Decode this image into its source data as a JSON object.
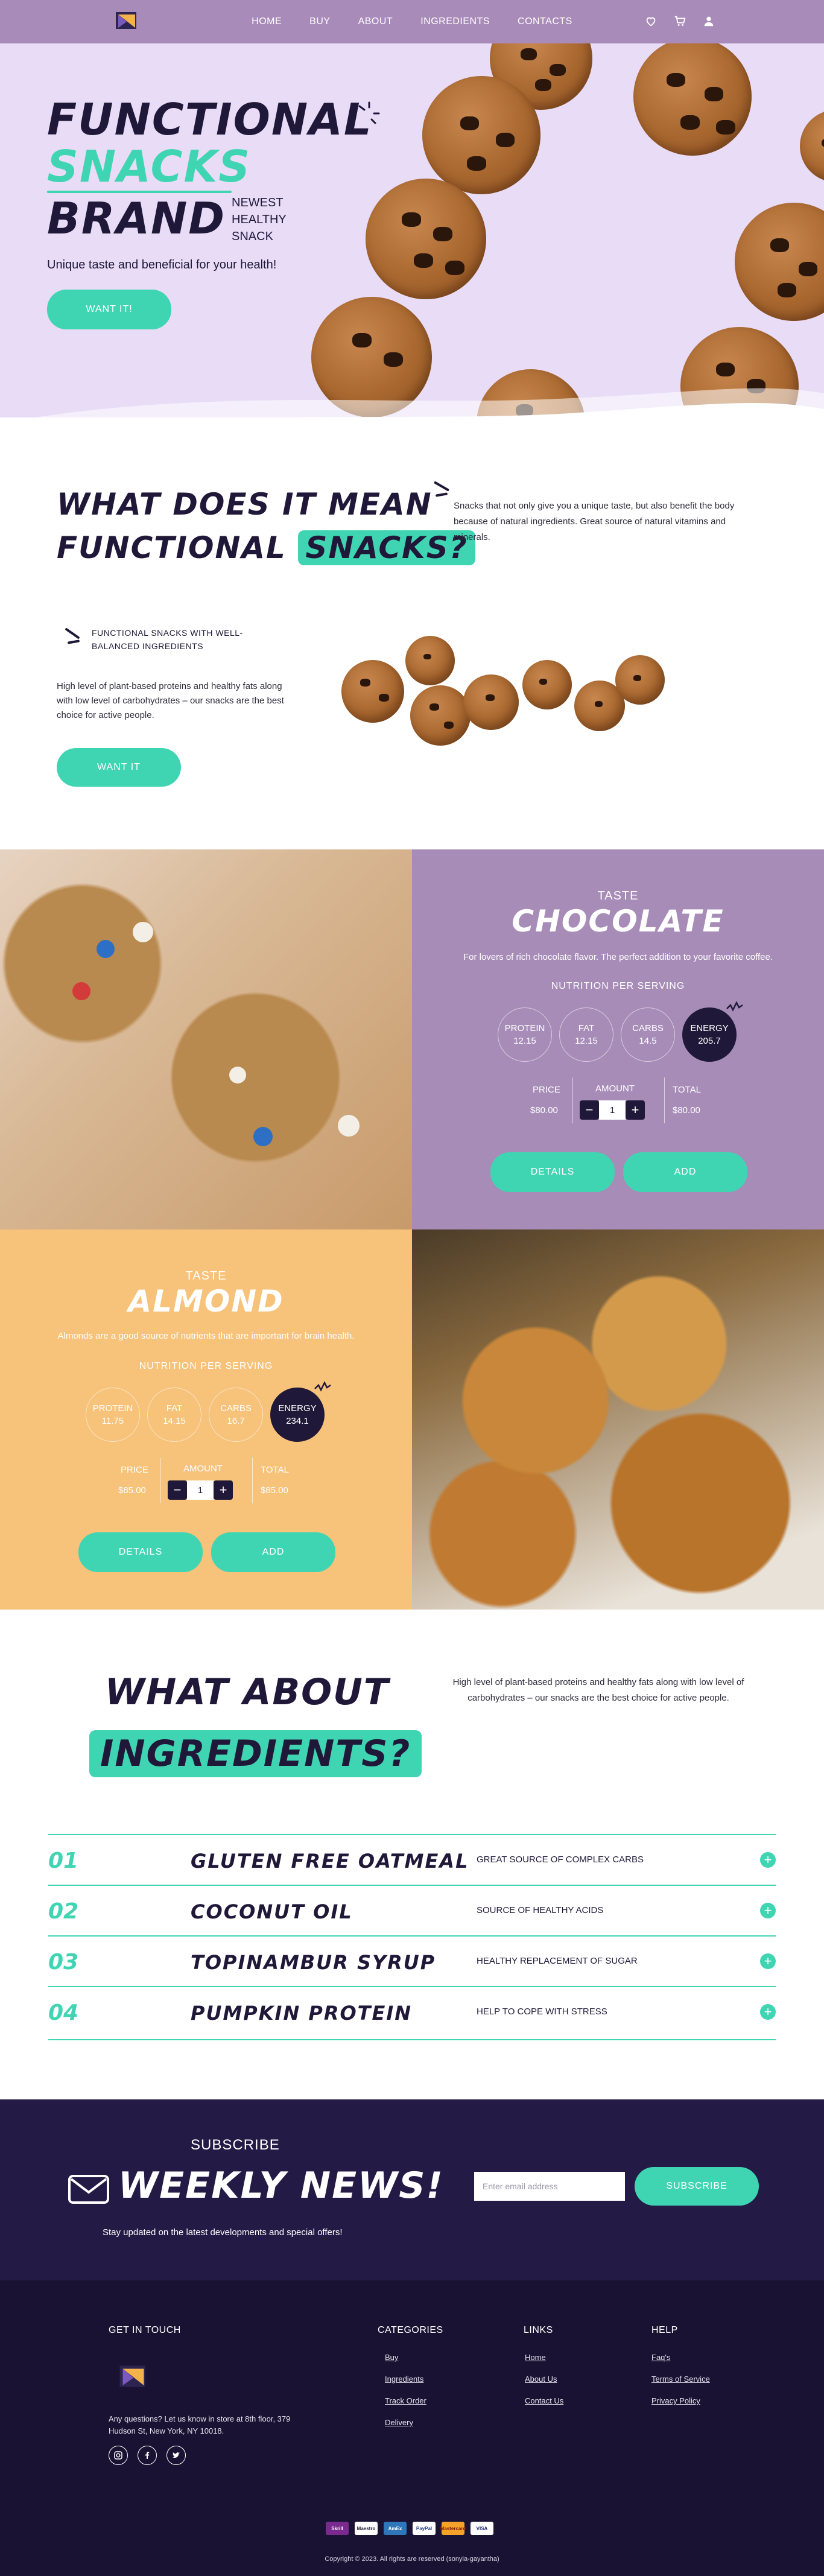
{
  "nav": {
    "items": [
      "HOME",
      "BUY",
      "ABOUT",
      "INGREDIENTS",
      "CONTACTS"
    ],
    "icons": [
      "heart-icon",
      "cart-icon",
      "user-icon"
    ]
  },
  "hero": {
    "line1": "FUNCTIONAL",
    "line2": "SNACKS",
    "line3": "BRAND",
    "tag1": "NEWEST",
    "tag2": "HEALTHY",
    "tag3": "SNACK",
    "subtitle": "Unique taste and beneficial for your health!",
    "cta": "WANT IT!"
  },
  "meaning": {
    "title_line1": "WHAT DOES IT MEAN",
    "title_line2_a": "FUNCTIONAL",
    "title_line2_b": "SNACKS?",
    "description": "Snacks that not only give you a unique taste, but also benefit the body because of natural ingredients. Great source of natural vitamins and minerals.",
    "feature_title": "FUNCTIONAL SNACKS WITH WELL-BALANCED INGREDIENTS",
    "feature_desc": "High level of plant-based proteins and healthy fats along with low level of carbohydrates – our snacks are the best choice for active people.",
    "cta": "WANT IT"
  },
  "products": [
    {
      "taste_label": "TASTE",
      "name": "CHOCOLATE",
      "description": "For lovers of rich chocolate flavor. The perfect addition to your favorite coffee.",
      "nutrition_label": "NUTRITION PER SERVING",
      "nutrients": [
        {
          "label": "PROTEIN",
          "value": "12.15"
        },
        {
          "label": "FAT",
          "value": "12.15"
        },
        {
          "label": "CARBS",
          "value": "14.5"
        },
        {
          "label": "ENERGY",
          "value": "205.7"
        }
      ],
      "price_label": "PRICE",
      "price": "$80.00",
      "amount_label": "AMOUNT",
      "amount": "1",
      "total_label": "TOTAL",
      "total": "$80.00",
      "details": "DETAILS",
      "add": "ADD",
      "panel_color": "#a78cb8"
    },
    {
      "taste_label": "TASTE",
      "name": "ALMOND",
      "description": "Almonds are a good source of nutrients that are important for brain health.",
      "nutrition_label": "NUTRITION PER SERVING",
      "nutrients": [
        {
          "label": "PROTEIN",
          "value": "11.75"
        },
        {
          "label": "FAT",
          "value": "14.15"
        },
        {
          "label": "CARBS",
          "value": "16.7"
        },
        {
          "label": "ENERGY",
          "value": "234.1"
        }
      ],
      "price_label": "PRICE",
      "price": "$85.00",
      "amount_label": "AMOUNT",
      "amount": "1",
      "total_label": "TOTAL",
      "total": "$85.00",
      "details": "DETAILS",
      "add": "ADD",
      "panel_color": "#f7c27a"
    }
  ],
  "ingredients": {
    "title_line1": "WHAT ABOUT",
    "title_line2": "INGREDIENTS?",
    "description": "High level of plant-based proteins and healthy fats along with low level of carbohydrates – our snacks are the best choice for active people.",
    "items": [
      {
        "num": "01",
        "name": "GLUTEN FREE OATMEAL",
        "benefit": "GREAT SOURCE OF COMPLEX CARBS"
      },
      {
        "num": "02",
        "name": "COCONUT OIL",
        "benefit": "SOURCE OF HEALTHY ACIDS"
      },
      {
        "num": "03",
        "name": "TOPINAMBUR SYRUP",
        "benefit": "HEALTHY REPLACEMENT OF SUGAR"
      },
      {
        "num": "04",
        "name": "PUMPKIN PROTEIN",
        "benefit": "HELP TO COPE WITH STRESS"
      }
    ]
  },
  "subscribe": {
    "label": "SUBSCRIBE",
    "title": "WEEKLY NEWS!",
    "text": "Stay updated on the latest developments and special offers!",
    "email_placeholder": "Enter email address",
    "button": "SUBSCRIBE"
  },
  "footer": {
    "contact_heading": "GET IN TOUCH",
    "address": "Any questions? Let us know in store at 8th floor, 379 Hudson St, New York, NY 10018.",
    "social": [
      "instagram-icon",
      "facebook-icon",
      "twitter-icon"
    ],
    "categories_heading": "CATEGORIES",
    "categories": [
      "Buy",
      "Ingredients",
      "Track Order",
      "Delivery"
    ],
    "links_heading": "LINKS",
    "links": [
      "Home",
      "About Us",
      "Contact Us"
    ],
    "help_heading": "HELP",
    "help": [
      "Faq's",
      "Terms of Service",
      "Privacy Policy"
    ],
    "payments": [
      "Skrill",
      "Maestro",
      "AmEx",
      "PayPal",
      "Mastercard",
      "VISA"
    ],
    "copyright": "Copyright © 2023. All rights are reserved (sonyia-gayantha)"
  },
  "colors": {
    "header": "#a98bb9",
    "hero_bg": "#e8dcf7",
    "accent": "#3fd5b3",
    "dark": "#1f1838",
    "subscribe_bg": "#231a46",
    "footer_bg": "#1a1233"
  }
}
